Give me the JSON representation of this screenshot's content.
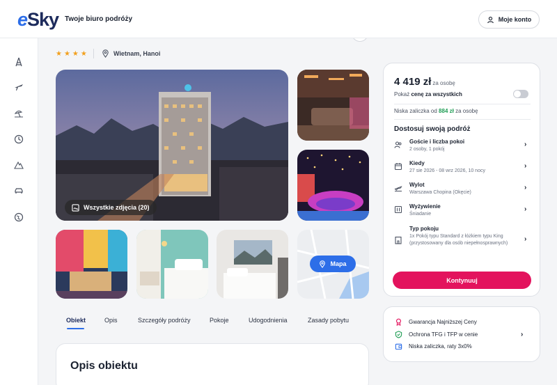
{
  "header": {
    "logo_e": "e",
    "logo_rest": "Sky",
    "tagline": "Twoje biuro podróży",
    "account_label": "Moje konto"
  },
  "sidebar": {
    "icons": [
      "hotel-icon",
      "flight-icon",
      "beach-icon",
      "clock-icon",
      "mountain-icon",
      "car-icon",
      "globe-icon"
    ]
  },
  "hotel": {
    "stars": "★★★★",
    "location": "Wietnam, Hanoi",
    "all_photos": "Wszystkie zdjęcia (20)",
    "map_label": "Mapa"
  },
  "tabs": [
    {
      "label": "Obiekt",
      "active": true
    },
    {
      "label": "Opis"
    },
    {
      "label": "Szczegóły podróży"
    },
    {
      "label": "Pokoje"
    },
    {
      "label": "Udogodnienia"
    },
    {
      "label": "Zasady pobytu"
    }
  ],
  "description": {
    "title": "Opis obiektu"
  },
  "booking": {
    "price": "4 419 zł",
    "price_suffix": "za osobę",
    "show_all_prefix": "Pokaż",
    "show_all_bold": "cenę za wszystkich",
    "deposit_prefix": "Niska zaliczka od",
    "deposit_value": "884 zł",
    "deposit_suffix": "za osobę",
    "customize_title": "Dostosuj swoją podróż",
    "options": [
      {
        "title": "Goście i liczba pokoi",
        "sub": "2 osoby, 1 pokój",
        "icon": "guests-icon"
      },
      {
        "title": "Kiedy",
        "sub": "27 sie 2026 - 08 wrz 2026, 10 nocy",
        "icon": "calendar-icon"
      },
      {
        "title": "Wylot",
        "sub": "Warszawa Chopina (Okęcie)",
        "icon": "departure-icon"
      },
      {
        "title": "Wyżywienie",
        "sub": "Śniadanie",
        "icon": "meal-icon"
      },
      {
        "title": "Typ pokoju",
        "sub": "1x Pokój typu Standard z łóżkiem typu King (przystosowany dla osób niepełnosprawnych)",
        "icon": "room-icon"
      }
    ],
    "continue_label": "Kontynuuj"
  },
  "guarantees": [
    {
      "label": "Gwarancja Najniższej Ceny",
      "color": "#e3135d",
      "icon": "medal-icon"
    },
    {
      "label": "Ochrona TFG i TFP w cenie",
      "color": "#1f9d55",
      "icon": "shield-icon"
    },
    {
      "label": "Niska zaliczka, raty 3x0%",
      "color": "#2d6ee8",
      "icon": "wallet-icon"
    }
  ],
  "colors": {
    "brand_blue": "#2d6ee8",
    "cta_pink": "#e3135d",
    "star": "#f2a01e",
    "deposit_green": "#1f9d55"
  }
}
